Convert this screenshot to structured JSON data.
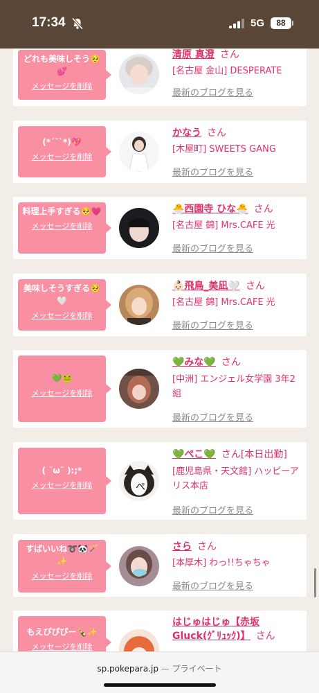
{
  "status": {
    "time": "17:34",
    "network": "5G",
    "battery": "88"
  },
  "browser": {
    "domain": "sp.pokepara.jp",
    "separator": "—",
    "mode": "プライベート"
  },
  "entries": [
    {
      "message": "どれも美味しそう🥺💕",
      "delete_label": "メッセージを削除",
      "name": "清原 真澄",
      "honorific": "さん",
      "shop": "[名古屋 金山] DESPERATE",
      "blog_link": "最新のブログを見る"
    },
    {
      "message": "(*ˊ˘ˋ*)💖",
      "delete_label": "メッセージを削除",
      "name": "かなう",
      "honorific": "さん",
      "shop": "[木屋町] SWEETS GANG",
      "blog_link": "最新のブログを見る"
    },
    {
      "message": "料理上手すぎる🥺💗",
      "delete_label": "メッセージを削除",
      "name": "🐣西園寺 ひな🐣",
      "honorific": "さん",
      "shop": "[名古屋 錦] Mrs.CAFE 光",
      "blog_link": "最新のブログを見る"
    },
    {
      "message": "美味しそうすぎる🥺🤍",
      "delete_label": "メッセージを削除",
      "name": "👶🏻飛鳥_美凪🤍",
      "honorific": "さん",
      "shop": "[名古屋 錦] Mrs.CAFE 光",
      "blog_link": "最新のブログを見る"
    },
    {
      "message": "💚🐸",
      "delete_label": "メッセージを削除",
      "name": "💚みな💚",
      "honorific": "さん",
      "shop": "[中洲] エンジェル女学園 3年2組",
      "blog_link": "最新のブログを見る"
    },
    {
      "message": "( ˘ω˘ ):;*",
      "delete_label": "メッセージを削除",
      "name": "💚ぺこ💚",
      "honorific": "さん",
      "status_tag": "[本日出勤]",
      "shop": "[鹿児島県・天文館] ハッピーアリス本店",
      "blog_link": "最新のブログを見る"
    },
    {
      "message": "すばいいね➰🐼🪄✨",
      "delete_label": "メッセージを削除",
      "name": "さら",
      "honorific": "さん",
      "shop": "[本厚木] わっ!!ちゃちゃ",
      "blog_link": "最新のブログを見る"
    },
    {
      "message": "もえぴぴぴー🍾✨",
      "delete_label": "メッセージを削除",
      "name": "はじゅはじゅ【赤坂Gluck(ｸﾞﾘｭｯｸ)】",
      "honorific": "さん",
      "shop": "",
      "blog_link": ""
    }
  ]
}
